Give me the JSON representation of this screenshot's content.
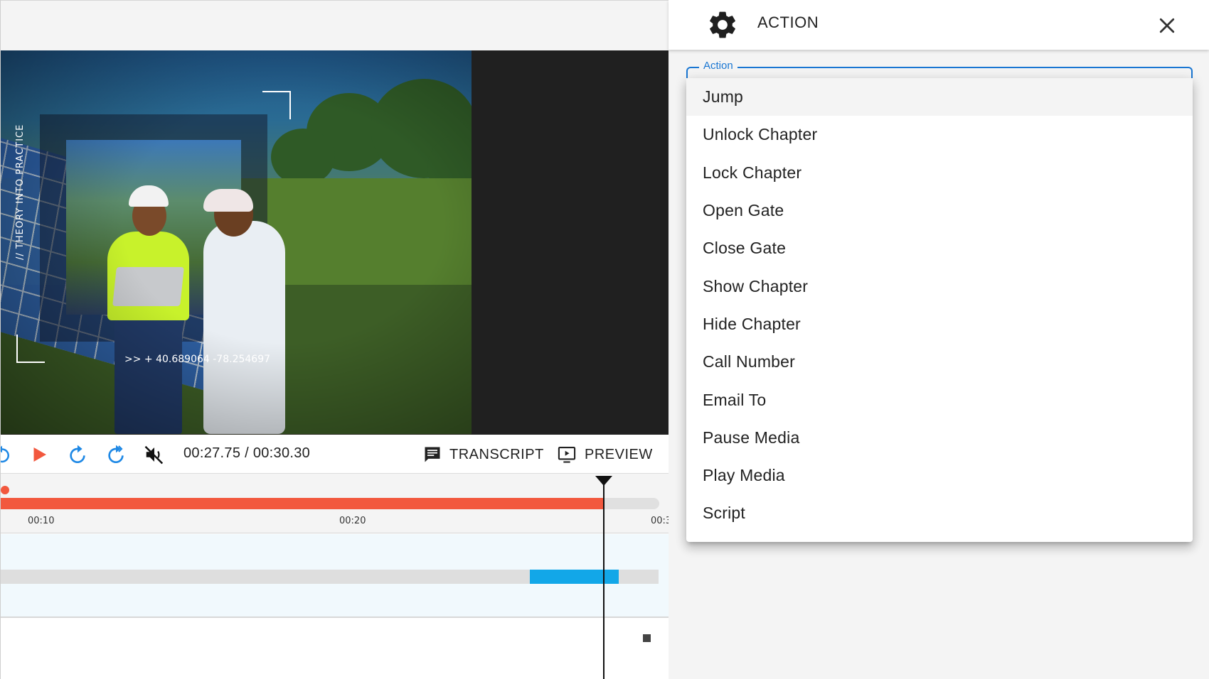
{
  "video": {
    "overlay_label": "// THEORY INTO PRACTICE",
    "coordinates": ">> + 40.689064  -78.254697"
  },
  "controls": {
    "time_display": "00:27.75 / 00:30.30",
    "transcript_label": "TRANSCRIPT",
    "preview_label": "PREVIEW"
  },
  "timeline": {
    "progress": 0.9158,
    "ticks": [
      "00:10",
      "00:20",
      "00:3"
    ],
    "clip": {
      "start": 0.791,
      "end": 0.925
    }
  },
  "panel": {
    "title": "ACTION",
    "field_label": "Action",
    "menu_items": [
      "Jump",
      "Unlock Chapter",
      "Lock Chapter",
      "Open Gate",
      "Close Gate",
      "Show Chapter",
      "Hide Chapter",
      "Call Number",
      "Email To",
      "Pause Media",
      "Play Media",
      "Script"
    ],
    "highlighted_item": "Jump"
  },
  "colors": {
    "accent_red": "#f2583e",
    "accent_blue": "#1976d2",
    "clip_blue": "#12a7e8"
  }
}
